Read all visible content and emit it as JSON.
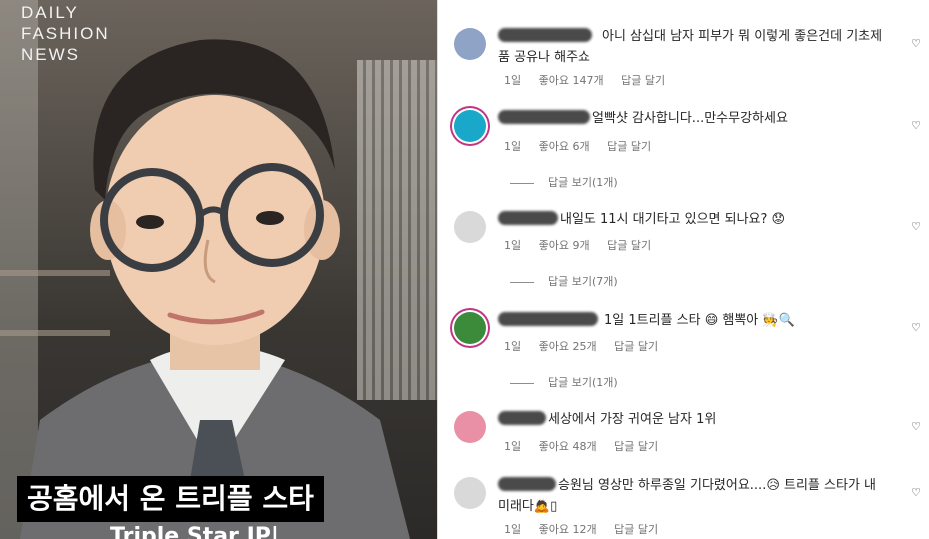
{
  "media": {
    "watermark": [
      "DAILY",
      "FASHION",
      "NEWS"
    ],
    "caption_line1": "공홈에서 온 트리플 스타",
    "caption_line2": "Triple Star IP|"
  },
  "comments": [
    {
      "text": "아니 삼십대 남자 피부가 뭐 이렇게 좋은건데 기초제품 공유나 해주쇼",
      "time": "1일",
      "likes": "좋아요 147개",
      "reply": "답글 달기",
      "replies_label": "",
      "avatar_color": "#8fa3c7"
    },
    {
      "text": "얼빡샷 감사합니다...만수무강하세요",
      "time": "1일",
      "likes": "좋아요 6개",
      "reply": "답글 달기",
      "replies_label": "답글 보기(1개)",
      "avatar_color": "#19a8c9"
    },
    {
      "text": "내일도 11시 대기타고 있으면 되나요? 😟",
      "time": "1일",
      "likes": "좋아요 9개",
      "reply": "답글 달기",
      "replies_label": "답글 보기(7개)",
      "avatar_color": "#d9d9d9"
    },
    {
      "text": "1일 1트리플 스타 😄 햄뽁아 🧑‍🍳🔍",
      "time": "1일",
      "likes": "좋아요 25개",
      "reply": "답글 달기",
      "replies_label": "답글 보기(1개)",
      "avatar_color": "#3c8b3a"
    },
    {
      "text": "세상에서 가장 귀여운 남자 1위",
      "time": "1일",
      "likes": "좋아요 48개",
      "reply": "답글 달기",
      "replies_label": "",
      "avatar_color": "#e98fa6"
    },
    {
      "text": "승원님 영상만 하루종일 기다렸어요....😥 트리플 스타가 내 미래다🙇▯",
      "time": "1일",
      "likes": "좋아요 12개",
      "reply": "답글 달기",
      "replies_label": "",
      "avatar_color": "#d9d9d9"
    }
  ],
  "icons": {
    "like": "heart-outline-icon"
  }
}
